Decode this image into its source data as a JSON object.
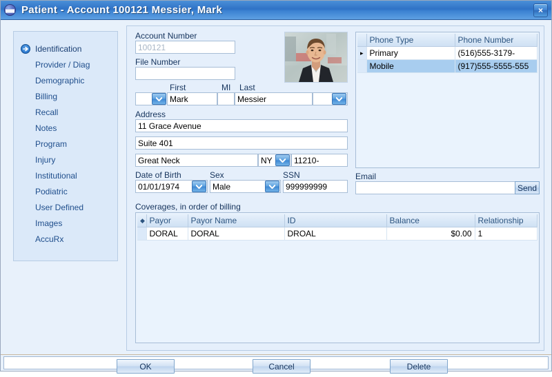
{
  "window": {
    "title": "Patient - Account 100121  Messier, Mark",
    "app_icon": "patient-circle-icon",
    "close_label": "×"
  },
  "sidebar": {
    "active_index": 0,
    "items": [
      {
        "label": "Identification"
      },
      {
        "label": "Provider / Diag"
      },
      {
        "label": "Demographic"
      },
      {
        "label": "Billing"
      },
      {
        "label": "Recall"
      },
      {
        "label": "Notes"
      },
      {
        "label": "Program"
      },
      {
        "label": "Injury"
      },
      {
        "label": "Institutional"
      },
      {
        "label": "Podiatric"
      },
      {
        "label": "User Defined"
      },
      {
        "label": "Images"
      },
      {
        "label": "AccuRx"
      }
    ]
  },
  "form": {
    "account_number": {
      "label": "Account Number",
      "value": "100121",
      "readonly": true
    },
    "file_number": {
      "label": "File Number",
      "value": ""
    },
    "name_row": {
      "prefix_label": "",
      "prefix_value": "",
      "first_label": "First",
      "first_value": "Mark",
      "mi_label": "MI",
      "mi_value": "",
      "last_label": "Last",
      "last_value": "Messier",
      "suffix_value": ""
    },
    "address": {
      "label": "Address",
      "line1": "11 Grace Avenue",
      "line2": "Suite 401",
      "city": "Great Neck",
      "state": "NY",
      "zip": "11210-"
    },
    "dob": {
      "label": "Date of Birth",
      "value": "01/01/1974"
    },
    "sex": {
      "label": "Sex",
      "value": "Male"
    },
    "ssn": {
      "label": "SSN",
      "value": "999999999"
    },
    "photo_alt": "patient-photo"
  },
  "phones": {
    "columns": [
      "Phone Type",
      "Phone Number"
    ],
    "rows": [
      {
        "mark": "▸",
        "type": "Primary",
        "number": "(516)555-3179-",
        "selected": false
      },
      {
        "mark": "",
        "type": "Mobile",
        "number": "(917)555-5555-555",
        "selected": true
      }
    ]
  },
  "email": {
    "label": "Email",
    "value": "",
    "send_label": "Send"
  },
  "coverages": {
    "label": "Coverages, in order of billing",
    "columns": [
      "Payor",
      "Payor Name",
      "ID",
      "Balance",
      "Relationship"
    ],
    "rows": [
      {
        "mark": "",
        "payor": "DORAL",
        "payor_name": "DORAL",
        "id": "DROAL",
        "balance": "$0.00",
        "relationship": "1"
      }
    ]
  },
  "buttons": {
    "ok": "OK",
    "cancel": "Cancel",
    "delete": "Delete"
  },
  "statusbar": {
    "text": ""
  },
  "colors": {
    "title_bar": "#2f72c6",
    "panel_bg": "#e5effb",
    "sidebar_bg": "#dbe9f9",
    "link_text": "#1f4e8c",
    "grid_selected": "#a8cdef"
  }
}
